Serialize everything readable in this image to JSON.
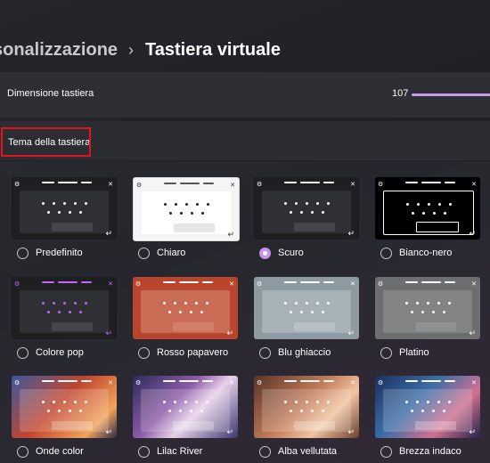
{
  "breadcrumb": {
    "parent": "sonalizzazione",
    "separator": "›",
    "current": "Tastiera virtuale"
  },
  "size_setting": {
    "label": "Dimensione tastiera",
    "value": "107",
    "accent": "#c79be6"
  },
  "theme_section": {
    "label": "Tema della tastiera",
    "highlight_color": "#e0161e"
  },
  "themes": [
    {
      "name": "Predefinito",
      "selected": false
    },
    {
      "name": "Chiaro",
      "selected": false
    },
    {
      "name": "Scuro",
      "selected": true
    },
    {
      "name": "Bianco-nero",
      "selected": false
    },
    {
      "name": "Colore pop",
      "selected": false
    },
    {
      "name": "Rosso papavero",
      "selected": false
    },
    {
      "name": "Blu ghiaccio",
      "selected": false
    },
    {
      "name": "Platino",
      "selected": false
    },
    {
      "name": "Onde color",
      "selected": false
    },
    {
      "name": "Lilac River",
      "selected": false
    },
    {
      "name": "Alba vellutata",
      "selected": false
    },
    {
      "name": "Brezza indaco",
      "selected": false
    }
  ],
  "icons": {
    "gear": "⚙",
    "close": "✕",
    "enter": "↵"
  }
}
